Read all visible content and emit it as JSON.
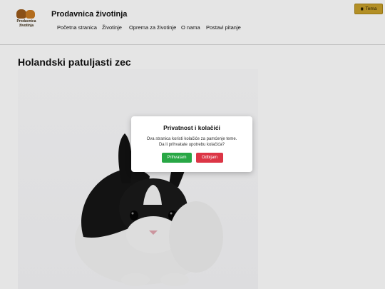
{
  "header": {
    "logo_text_line1": "Prodavnica",
    "logo_text_line2": "životinja",
    "site_title": "Prodavnica životinja",
    "nav": {
      "home": "Početna stranica",
      "animals": "Životinje",
      "equipment": "Oprema za životinje",
      "about": "O nama",
      "ask": "Postavi pitanje"
    },
    "theme_label": "Tema",
    "theme_icon": "moon-icon"
  },
  "main": {
    "title": "Holandski patuljasti zec",
    "image_subject": "rabbit-photo"
  },
  "cookie_modal": {
    "title": "Privatnost i kolačići",
    "text_line1": "Ova stranica koristi kolačiće za pamćenje teme.",
    "text_line2": "Da li prihvatate upotrebu kolačića?",
    "accept_label": "Prihvatam",
    "reject_label": "Odbijam"
  },
  "colors": {
    "accept": "#28a745",
    "reject": "#dc3545",
    "theme_button": "#c8a02a"
  }
}
